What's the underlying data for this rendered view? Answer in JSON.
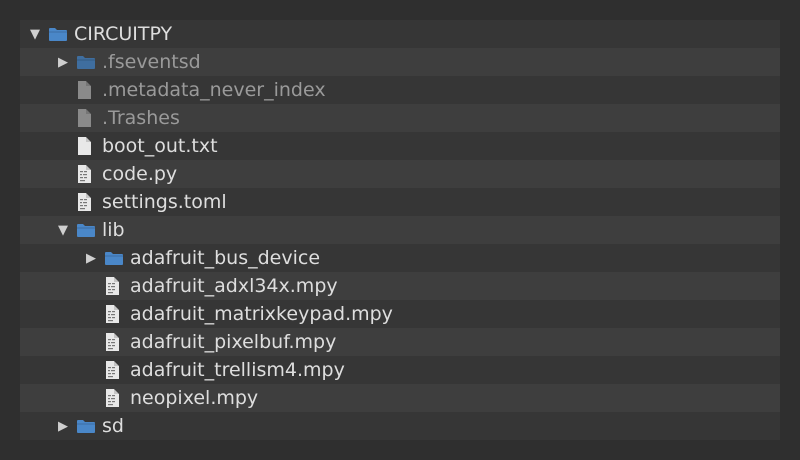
{
  "tree": [
    {
      "label": "CIRCUITPY",
      "depth": 0,
      "type": "folder",
      "expanded": true,
      "dim": false
    },
    {
      "label": ".fseventsd",
      "depth": 1,
      "type": "folder",
      "expanded": false,
      "dim": true
    },
    {
      "label": ".metadata_never_index",
      "depth": 1,
      "type": "file-blank",
      "dim": true
    },
    {
      "label": ".Trashes",
      "depth": 1,
      "type": "file-blank",
      "dim": true
    },
    {
      "label": "boot_out.txt",
      "depth": 1,
      "type": "file-blank",
      "dim": false
    },
    {
      "label": "code.py",
      "depth": 1,
      "type": "file-code",
      "dim": false
    },
    {
      "label": "settings.toml",
      "depth": 1,
      "type": "file-code",
      "dim": false
    },
    {
      "label": "lib",
      "depth": 1,
      "type": "folder",
      "expanded": true,
      "dim": false
    },
    {
      "label": "adafruit_bus_device",
      "depth": 2,
      "type": "folder",
      "expanded": false,
      "dim": false
    },
    {
      "label": "adafruit_adxl34x.mpy",
      "depth": 2,
      "type": "file-code",
      "dim": false
    },
    {
      "label": "adafruit_matrixkeypad.mpy",
      "depth": 2,
      "type": "file-code",
      "dim": false
    },
    {
      "label": "adafruit_pixelbuf.mpy",
      "depth": 2,
      "type": "file-code",
      "dim": false
    },
    {
      "label": "adafruit_trellism4.mpy",
      "depth": 2,
      "type": "file-code",
      "dim": false
    },
    {
      "label": "neopixel.mpy",
      "depth": 2,
      "type": "file-code",
      "dim": false
    },
    {
      "label": "sd",
      "depth": 1,
      "type": "folder",
      "expanded": false,
      "dim": false
    }
  ],
  "colors": {
    "folder": "#4a87c8",
    "folder_dim": "#3f6e9f",
    "file": "#e8e8e8",
    "file_dim": "#8a8a8a"
  },
  "icons": {
    "folder": "folder-icon",
    "file-blank": "file-icon",
    "file-code": "code-file-icon",
    "expanded": "triangle-down-icon",
    "collapsed": "triangle-right-icon"
  }
}
